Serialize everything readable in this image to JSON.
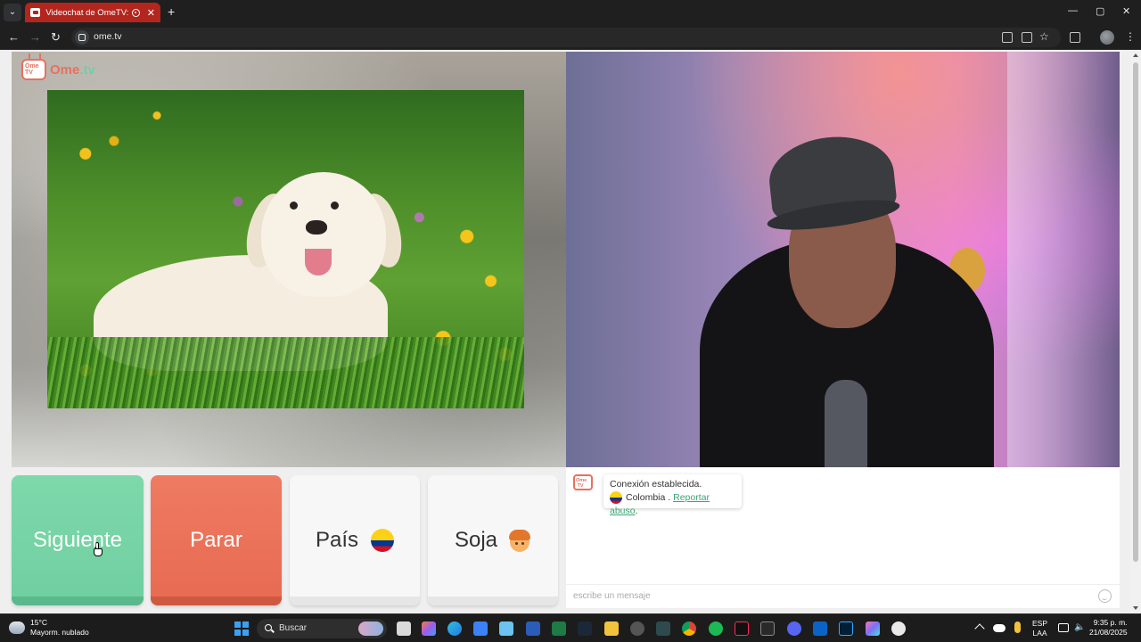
{
  "browser": {
    "tab_title": "Videochat de OmeTV: uno a uno",
    "tab_close": "✕",
    "new_tab": "+",
    "url": "ome.tv",
    "win_min": "—",
    "win_max": "▢",
    "win_close": "✕"
  },
  "site": {
    "logo_tv_top": "Ome",
    "logo_tv_bottom": "TV",
    "logo_name": "Ome",
    "logo_tld": ".tv"
  },
  "controls": {
    "next_label": "Siguiente",
    "stop_label": "Parar",
    "country_label": "País",
    "gender_label": "Soja"
  },
  "chat": {
    "status": "Conexión establecida.",
    "country": "Colombia",
    "separator": " . ",
    "report_link": "Reportar abuso",
    "report_suffix": ".",
    "input_placeholder": "escribe un mensaje"
  },
  "taskbar": {
    "temperature": "15°C",
    "weather_desc": "Mayorm. nublado",
    "search_label": "Buscar",
    "lang_line1": "ESP",
    "lang_line2": "LAA",
    "time": "9:35 p. m.",
    "date": "21/08/2025"
  },
  "colors": {
    "next": "#6fcfa0",
    "stop": "#e76a51",
    "brand": "#e8715d",
    "link": "#3aa675"
  }
}
